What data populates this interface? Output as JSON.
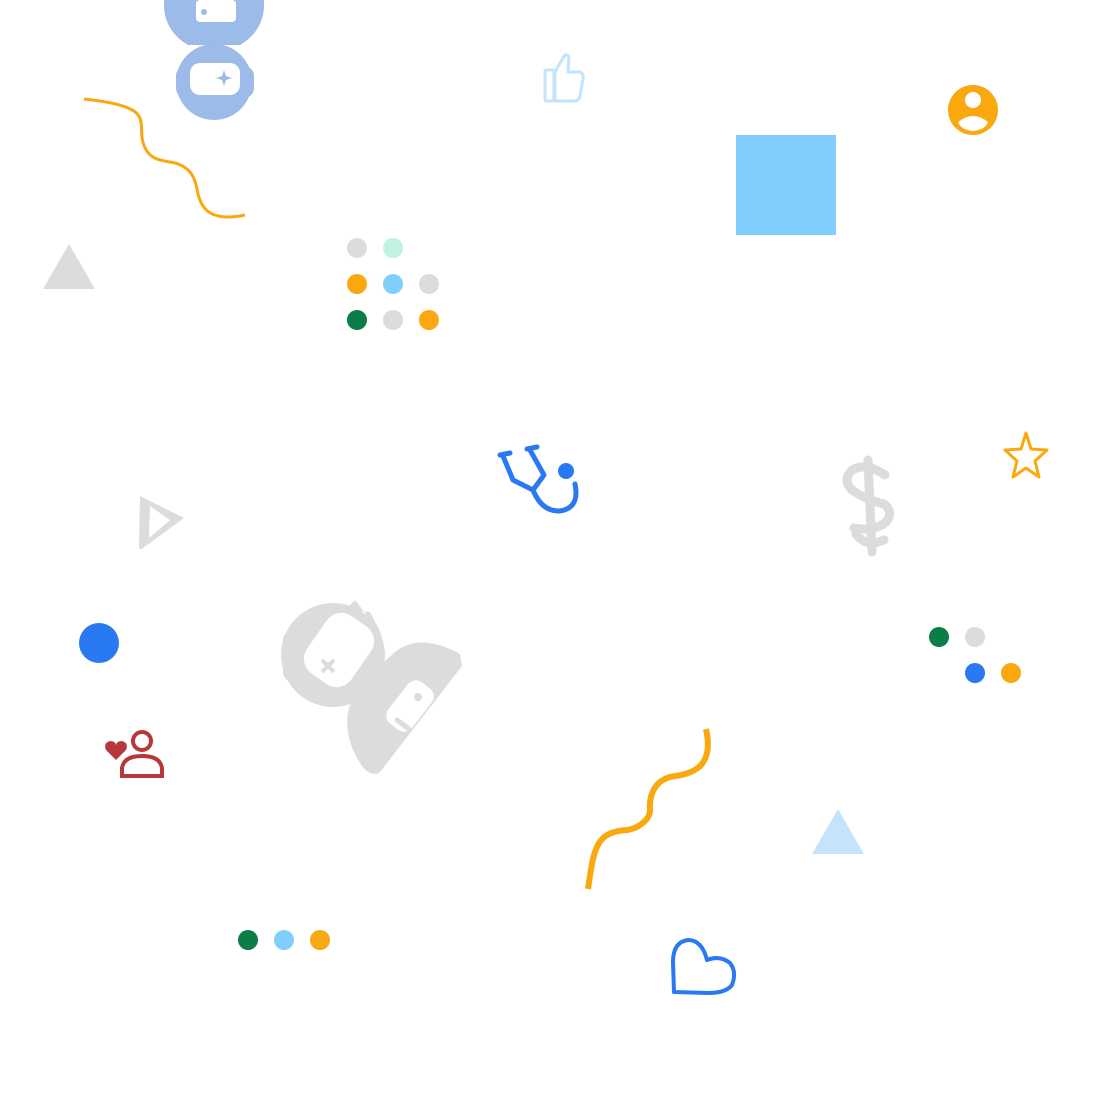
{
  "colors": {
    "blue": "#2979f2",
    "light_blue": "#7fcefc",
    "pale_blue": "#c5e4fb",
    "periwinkle": "#9cbbe9",
    "orange": "#f9a80f",
    "green": "#0b7d46",
    "mint": "#bff3df",
    "gray": "#dcdcdc",
    "red": "#b6383a",
    "background": "#ffffff"
  },
  "icons": [
    "stethoscope-icon",
    "thumbs-up-icon",
    "account-circle-icon",
    "star-outline-icon",
    "heart-outline-icon",
    "caduceus-icon",
    "volunteer-person-icon",
    "bandage-hand-icon",
    "bandage-icon",
    "paper-plane-icon"
  ],
  "shapes": [
    "triangle",
    "square",
    "circle",
    "wavy-line",
    "dot-grid"
  ]
}
